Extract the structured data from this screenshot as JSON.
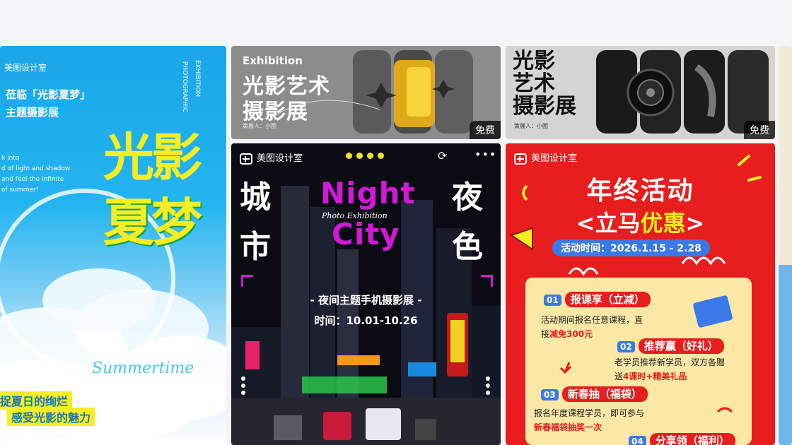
{
  "card1": {
    "brand": "美图设计室",
    "tagline_1": "莅临「光影夏梦」",
    "tagline_2": "主题摄影展",
    "side_text_1": "EXHIBITION",
    "side_text_2": "PHOTOGRAPHIC",
    "small_en_1": "k into",
    "small_en_2": "d of light and shadow",
    "small_en_3": "and feel the infinite",
    "small_en_4": "of summer!",
    "title_1": "光影",
    "title_2": "夏梦",
    "script": "Summertime",
    "bottom_1": "捉夏日的绚烂",
    "bottom_2": "感受光影的魅力"
  },
  "card2": {
    "label_en": "Exhibition",
    "title_1": "光影艺术",
    "title_2": "摄影展",
    "planner": "策展人：小图",
    "free": "免费"
  },
  "card3": {
    "title_1": "光影",
    "title_2": "艺术",
    "title_3": "摄影展",
    "planner": "策展人：小图",
    "free": "免费"
  },
  "card4": {
    "brand": "美图设计室",
    "left_1": "城",
    "left_2": "市",
    "right_1": "夜",
    "right_2": "色",
    "night": "Night",
    "city": "City",
    "script": "Photo Exhibition",
    "subtitle": "- 夜间主题手机摄影展 -",
    "time": "时间：10.01-10.26"
  },
  "card5": {
    "brand": "美图设计室",
    "title": "年终活动",
    "subtitle_pre": "<立马",
    "subtitle_hl": "优惠",
    "subtitle_post": ">",
    "date": "活动时间：2026.1.15 - 2.28",
    "items": [
      {
        "num": "01",
        "head": "报课享（立减）",
        "body_1": "活动期间报名任意课程，直",
        "body_2": "接",
        "body_hl": "减免300元",
        "body_3": ""
      },
      {
        "num": "02",
        "head": "推荐赢（好礼）",
        "body_1": "老学员推荐新学员，双方各赠",
        "body_2": "送",
        "body_hl": "4课时+精美礼品",
        "body_3": ""
      },
      {
        "num": "03",
        "head": "新春抽（福袋）",
        "body_1": "报名年度课程学员，即可参与",
        "body_2": "",
        "body_hl": "新春福袋抽奖一次",
        "body_3": ""
      },
      {
        "num": "04",
        "head": "分享领（福利）",
        "body_1": "",
        "body_2": "",
        "body_hl": "",
        "body_3": ""
      }
    ]
  },
  "colors": {
    "sky": "#1aa6e8",
    "yellow": "#f5ee22",
    "red": "#e81d1d",
    "magenta": "#d01ad6"
  }
}
